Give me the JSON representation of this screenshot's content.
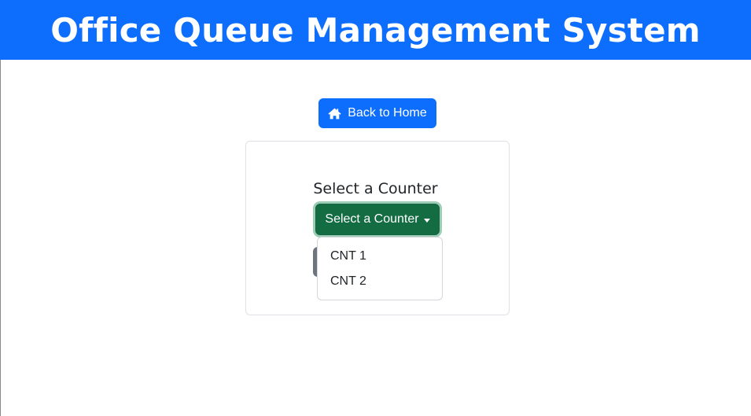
{
  "header": {
    "title": "Office Queue Management System"
  },
  "nav": {
    "back_label": "Back to Home"
  },
  "card": {
    "title": "Select a Counter",
    "dropdown": {
      "button_label": "Select a Counter",
      "expanded": true,
      "options": [
        "CNT 1",
        "CNT 2"
      ]
    }
  },
  "colors": {
    "primary": "#0d6efd",
    "success": "#146c43",
    "secondary": "#6c757d"
  }
}
